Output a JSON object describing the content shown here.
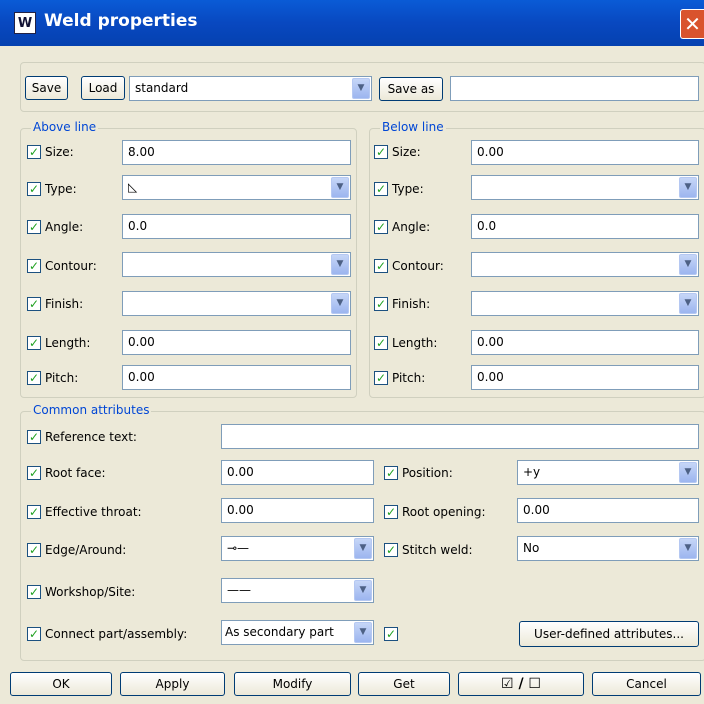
{
  "window": {
    "title": "Weld properties",
    "close_label": "✕"
  },
  "toolbar": {
    "save": "Save",
    "load": "Load",
    "preset": "standard",
    "save_as": "Save as",
    "save_as_value": ""
  },
  "above": {
    "legend": "Above line",
    "size": {
      "label": "Size:",
      "value": "8.00"
    },
    "type": {
      "label": "Type:",
      "value": "◺"
    },
    "angle": {
      "label": "Angle:",
      "value": "0.0"
    },
    "contour": {
      "label": "Contour:",
      "value": ""
    },
    "finish": {
      "label": "Finish:",
      "value": ""
    },
    "length": {
      "label": "Length:",
      "value": "0.00"
    },
    "pitch": {
      "label": "Pitch:",
      "value": "0.00"
    }
  },
  "below": {
    "legend": "Below line",
    "size": {
      "label": "Size:",
      "value": "0.00"
    },
    "type": {
      "label": "Type:",
      "value": ""
    },
    "angle": {
      "label": "Angle:",
      "value": "0.0"
    },
    "contour": {
      "label": "Contour:",
      "value": ""
    },
    "finish": {
      "label": "Finish:",
      "value": ""
    },
    "length": {
      "label": "Length:",
      "value": "0.00"
    },
    "pitch": {
      "label": "Pitch:",
      "value": "0.00"
    }
  },
  "common": {
    "legend": "Common attributes",
    "reference_text": {
      "label": "Reference text:",
      "value": ""
    },
    "root_face": {
      "label": "Root face:",
      "value": "0.00"
    },
    "position": {
      "label": "Position:",
      "value": "+y"
    },
    "effective_throat": {
      "label": "Effective throat:",
      "value": "0.00"
    },
    "root_opening": {
      "label": "Root opening:",
      "value": "0.00"
    },
    "edge_around": {
      "label": "Edge/Around:",
      "value": "⊸—"
    },
    "stitch_weld": {
      "label": "Stitch weld:",
      "value": "No"
    },
    "workshop_site": {
      "label": "Workshop/Site:",
      "value": "——"
    },
    "connect": {
      "label": "Connect part/assembly:",
      "value": "As secondary part"
    },
    "user_defined": "User-defined attributes..."
  },
  "footer": {
    "ok": "OK",
    "apply": "Apply",
    "modify": "Modify",
    "get": "Get",
    "toggle": "☑ / ☐",
    "cancel": "Cancel"
  },
  "colors": {
    "title_bar": "#0848c0",
    "legend": "#0046d5",
    "check": "#21a121"
  }
}
